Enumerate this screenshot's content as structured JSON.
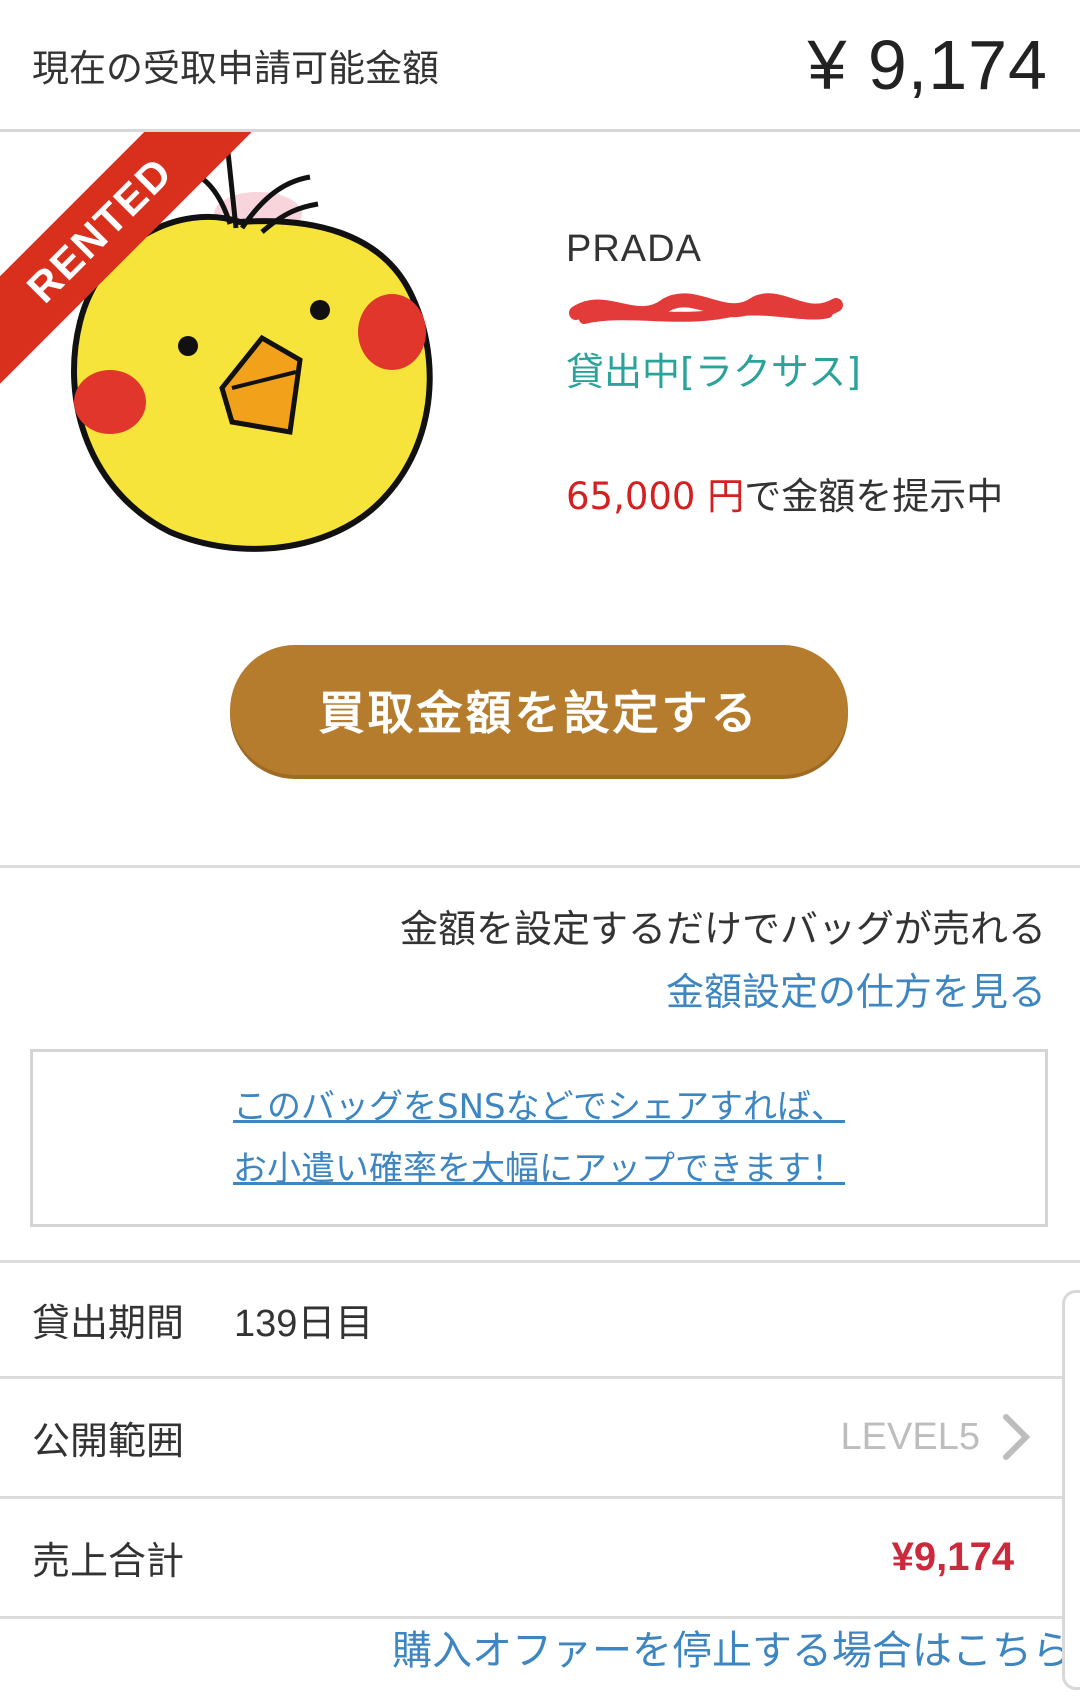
{
  "header": {
    "label": "現在の受取申請可能金額",
    "amount": "¥ 9,174"
  },
  "item": {
    "ribbon": "RENTED",
    "image_icon": "chick-illustration-icon",
    "brand": "PRADA",
    "status": "貸出中[ラクサス]",
    "offer_price": "65,000 円",
    "offer_suffix": "で金額を提示中"
  },
  "set_button": {
    "label": "買取金額を設定する"
  },
  "tip": {
    "line1": "金額を設定するだけでバッグが売れる",
    "link": "金額設定の仕方を見る"
  },
  "share": {
    "line1": "このバッグをSNSなどでシェアすれば、",
    "line2": "お小遣い確率を大幅にアップできます！"
  },
  "rows": {
    "period_label": "貸出期間",
    "period_value": "139日目",
    "visibility_label": "公開範囲",
    "visibility_value": "LEVEL5",
    "sales_label": "売上合計",
    "sales_value": "¥9,174"
  },
  "footer": {
    "stop_link": "購入オファーを停止する場合はこちら"
  },
  "colors": {
    "accent_button": "#b57c2e",
    "status_teal": "#2aa39a",
    "price_red": "#d42020",
    "link_blue": "#3e86c2",
    "ribbon_red": "#d9301e"
  }
}
